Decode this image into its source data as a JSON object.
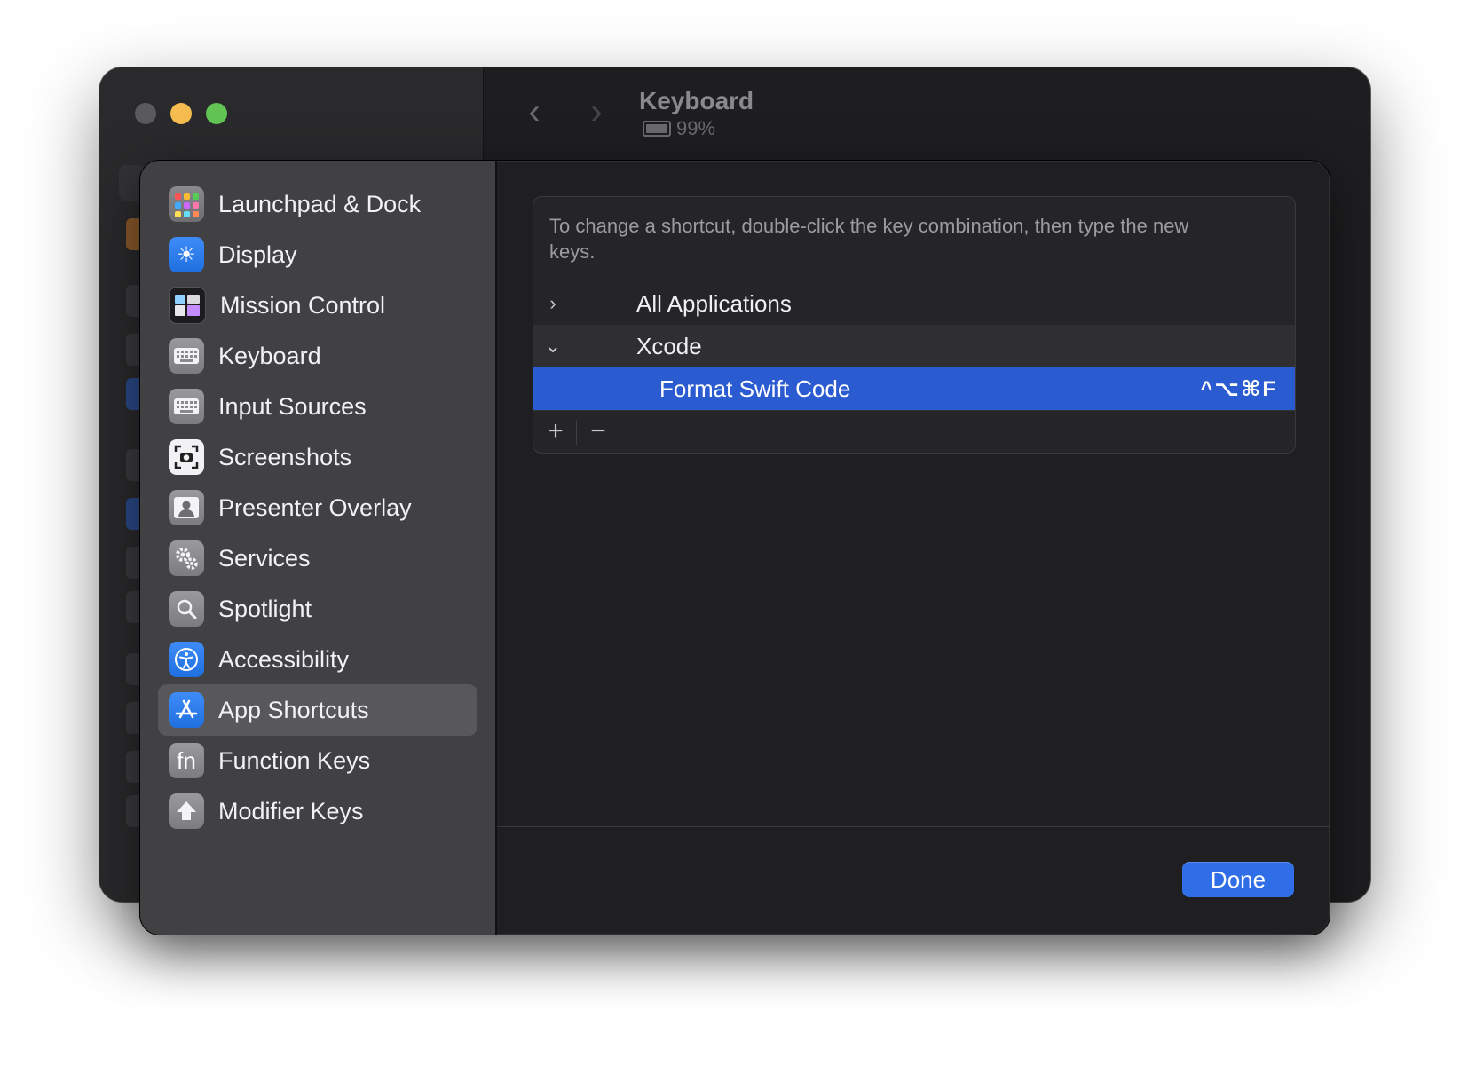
{
  "window": {
    "title": "Keyboard",
    "battery_text": "99%"
  },
  "sidebar": {
    "items": [
      {
        "label": "Launchpad & Dock",
        "icon": "launchpad-icon"
      },
      {
        "label": "Display",
        "icon": "sun-icon"
      },
      {
        "label": "Mission Control",
        "icon": "mission-control-icon"
      },
      {
        "label": "Keyboard",
        "icon": "keyboard-icon"
      },
      {
        "label": "Input Sources",
        "icon": "keyboard-icon"
      },
      {
        "label": "Screenshots",
        "icon": "camera-icon"
      },
      {
        "label": "Presenter Overlay",
        "icon": "person-icon"
      },
      {
        "label": "Services",
        "icon": "gears-icon"
      },
      {
        "label": "Spotlight",
        "icon": "magnifier-icon"
      },
      {
        "label": "Accessibility",
        "icon": "accessibility-icon"
      },
      {
        "label": "App Shortcuts",
        "icon": "app-store-icon",
        "selected": true
      },
      {
        "label": "Function Keys",
        "icon": "fn-icon"
      },
      {
        "label": "Modifier Keys",
        "icon": "shift-arrow-icon"
      }
    ]
  },
  "shortcuts": {
    "hint": "To change a shortcut, double-click the key combination, then type the new keys.",
    "all_applications": "All Applications",
    "app_group": "Xcode",
    "entry": {
      "label": "Format Swift Code",
      "keys": "^⌥⌘F"
    },
    "add_label": "+",
    "remove_label": "−"
  },
  "footer": {
    "done_label": "Done"
  },
  "colors": {
    "accent": "#2f6ee6",
    "selection": "#2a5bd0"
  }
}
